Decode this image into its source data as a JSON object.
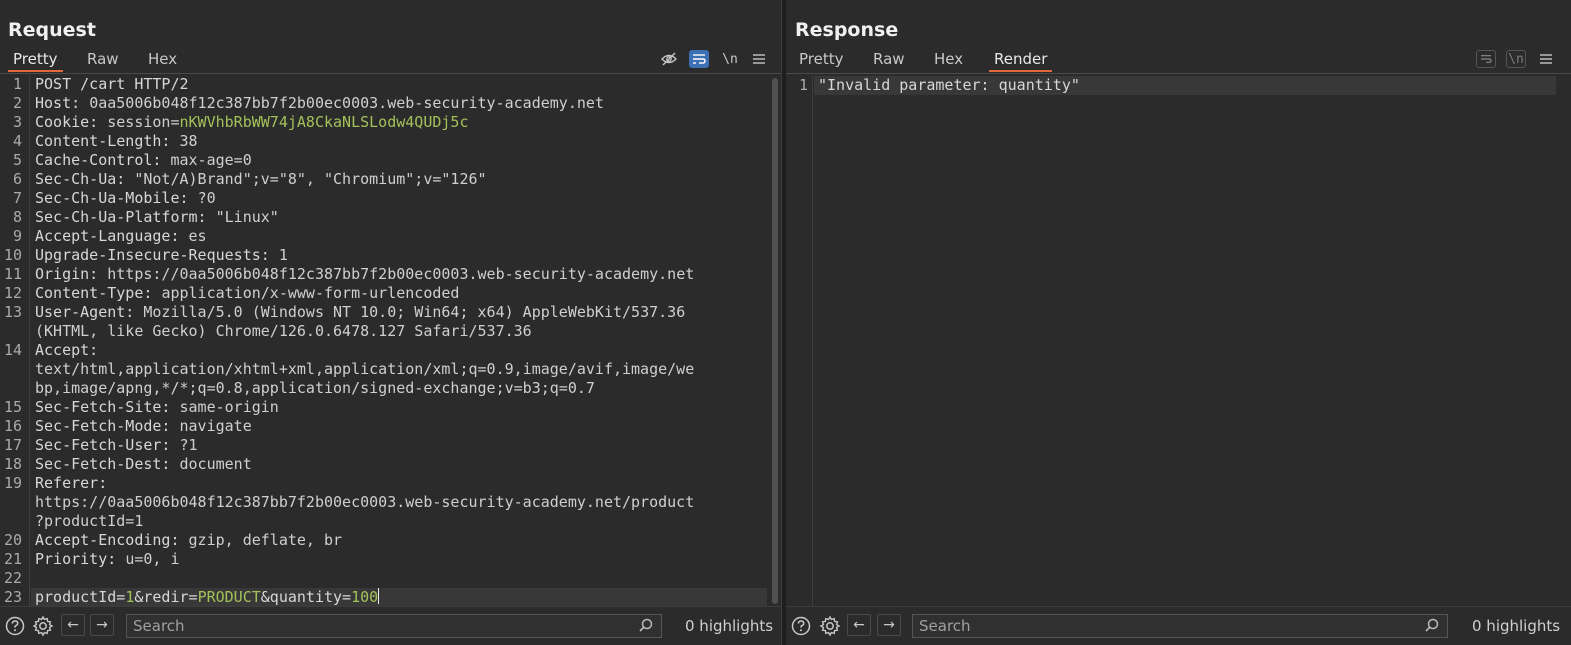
{
  "request": {
    "title": "Request",
    "tabs": [
      "Pretty",
      "Raw",
      "Hex"
    ],
    "active_tab": "Pretty",
    "toolbar_icons": [
      "hide-icon",
      "wrap-icon",
      "newline-icon",
      "menu-icon"
    ],
    "newline_label": "\\n",
    "lines": [
      {
        "n": "1",
        "parts": [
          {
            "t": "POST /cart HTTP/2",
            "c": "k"
          }
        ]
      },
      {
        "n": "2",
        "parts": [
          {
            "t": "Host: ",
            "c": "k"
          },
          {
            "t": "0aa5006b048f12c387bb7f2b00ec0003.web-security-academy.net",
            "c": "v"
          }
        ]
      },
      {
        "n": "3",
        "parts": [
          {
            "t": "Cookie: ",
            "c": "k"
          },
          {
            "t": "session=",
            "c": "v"
          },
          {
            "t": "nKWVhbRbWW74jA8CkaNLSLodw4QUDj5c",
            "c": "g"
          }
        ]
      },
      {
        "n": "4",
        "parts": [
          {
            "t": "Content-Length: ",
            "c": "k"
          },
          {
            "t": "38",
            "c": "v"
          }
        ]
      },
      {
        "n": "5",
        "parts": [
          {
            "t": "Cache-Control: ",
            "c": "k"
          },
          {
            "t": "max-age=0",
            "c": "v"
          }
        ]
      },
      {
        "n": "6",
        "parts": [
          {
            "t": "Sec-Ch-Ua: ",
            "c": "k"
          },
          {
            "t": "\"Not/A)Brand\";v=\"8\", \"Chromium\";v=\"126\"",
            "c": "v"
          }
        ]
      },
      {
        "n": "7",
        "parts": [
          {
            "t": "Sec-Ch-Ua-Mobile: ",
            "c": "k"
          },
          {
            "t": "?0",
            "c": "v"
          }
        ]
      },
      {
        "n": "8",
        "parts": [
          {
            "t": "Sec-Ch-Ua-Platform: ",
            "c": "k"
          },
          {
            "t": "\"Linux\"",
            "c": "v"
          }
        ]
      },
      {
        "n": "9",
        "parts": [
          {
            "t": "Accept-Language: ",
            "c": "k"
          },
          {
            "t": "es",
            "c": "v"
          }
        ]
      },
      {
        "n": "10",
        "parts": [
          {
            "t": "Upgrade-Insecure-Requests: ",
            "c": "k"
          },
          {
            "t": "1",
            "c": "v"
          }
        ]
      },
      {
        "n": "11",
        "parts": [
          {
            "t": "Origin: ",
            "c": "k"
          },
          {
            "t": "https://0aa5006b048f12c387bb7f2b00ec0003.web-security-academy.net",
            "c": "v"
          }
        ]
      },
      {
        "n": "12",
        "parts": [
          {
            "t": "Content-Type: ",
            "c": "k"
          },
          {
            "t": "application/x-www-form-urlencoded",
            "c": "v"
          }
        ]
      },
      {
        "n": "13",
        "parts": [
          {
            "t": "User-Agent: ",
            "c": "k"
          },
          {
            "t": "Mozilla/5.0 (Windows NT 10.0; Win64; x64) AppleWebKit/537.36",
            "c": "v"
          }
        ]
      },
      {
        "n": "",
        "parts": [
          {
            "t": "(KHTML, like Gecko) Chrome/126.0.6478.127 Safari/537.36",
            "c": "v"
          }
        ]
      },
      {
        "n": "14",
        "parts": [
          {
            "t": "Accept: ",
            "c": "k"
          }
        ]
      },
      {
        "n": "",
        "parts": [
          {
            "t": "text/html,application/xhtml+xml,application/xml;q=0.9,image/avif,image/we",
            "c": "v"
          }
        ]
      },
      {
        "n": "",
        "parts": [
          {
            "t": "bp,image/apng,*/*;q=0.8,application/signed-exchange;v=b3;q=0.7",
            "c": "v"
          }
        ]
      },
      {
        "n": "15",
        "parts": [
          {
            "t": "Sec-Fetch-Site: ",
            "c": "k"
          },
          {
            "t": "same-origin",
            "c": "v"
          }
        ]
      },
      {
        "n": "16",
        "parts": [
          {
            "t": "Sec-Fetch-Mode: ",
            "c": "k"
          },
          {
            "t": "navigate",
            "c": "v"
          }
        ]
      },
      {
        "n": "17",
        "parts": [
          {
            "t": "Sec-Fetch-User: ",
            "c": "k"
          },
          {
            "t": "?1",
            "c": "v"
          }
        ]
      },
      {
        "n": "18",
        "parts": [
          {
            "t": "Sec-Fetch-Dest: ",
            "c": "k"
          },
          {
            "t": "document",
            "c": "v"
          }
        ]
      },
      {
        "n": "19",
        "parts": [
          {
            "t": "Referer: ",
            "c": "k"
          }
        ]
      },
      {
        "n": "",
        "parts": [
          {
            "t": "https://0aa5006b048f12c387bb7f2b00ec0003.web-security-academy.net/product",
            "c": "v"
          }
        ]
      },
      {
        "n": "",
        "parts": [
          {
            "t": "?productId=1",
            "c": "v"
          }
        ]
      },
      {
        "n": "20",
        "parts": [
          {
            "t": "Accept-Encoding: ",
            "c": "k"
          },
          {
            "t": "gzip, deflate, br",
            "c": "v"
          }
        ]
      },
      {
        "n": "21",
        "parts": [
          {
            "t": "Priority: ",
            "c": "k"
          },
          {
            "t": "u=0, i",
            "c": "v"
          }
        ]
      },
      {
        "n": "22",
        "parts": []
      },
      {
        "n": "23",
        "current": true,
        "parts": [
          {
            "t": "productId=",
            "c": "k"
          },
          {
            "t": "1",
            "c": "g"
          },
          {
            "t": "&redir=",
            "c": "k"
          },
          {
            "t": "PRODUCT",
            "c": "g"
          },
          {
            "t": "&quantity=",
            "c": "k"
          },
          {
            "t": "100",
            "c": "g"
          }
        ]
      }
    ],
    "search_placeholder": "Search",
    "highlights": "0 highlights"
  },
  "response": {
    "title": "Response",
    "tabs": [
      "Pretty",
      "Raw",
      "Hex",
      "Render"
    ],
    "active_tab": "Render",
    "toolbar_icons": [
      "wrap-icon",
      "newline-icon",
      "menu-icon"
    ],
    "newline_label": "\\n",
    "lines": [
      {
        "n": "1",
        "parts": [
          {
            "t": "\"Invalid parameter: quantity\"",
            "c": "k"
          }
        ]
      }
    ],
    "search_placeholder": "Search",
    "highlights": "0 highlights"
  },
  "layout_buttons": [
    "side-by-side",
    "top-bottom",
    "single"
  ]
}
